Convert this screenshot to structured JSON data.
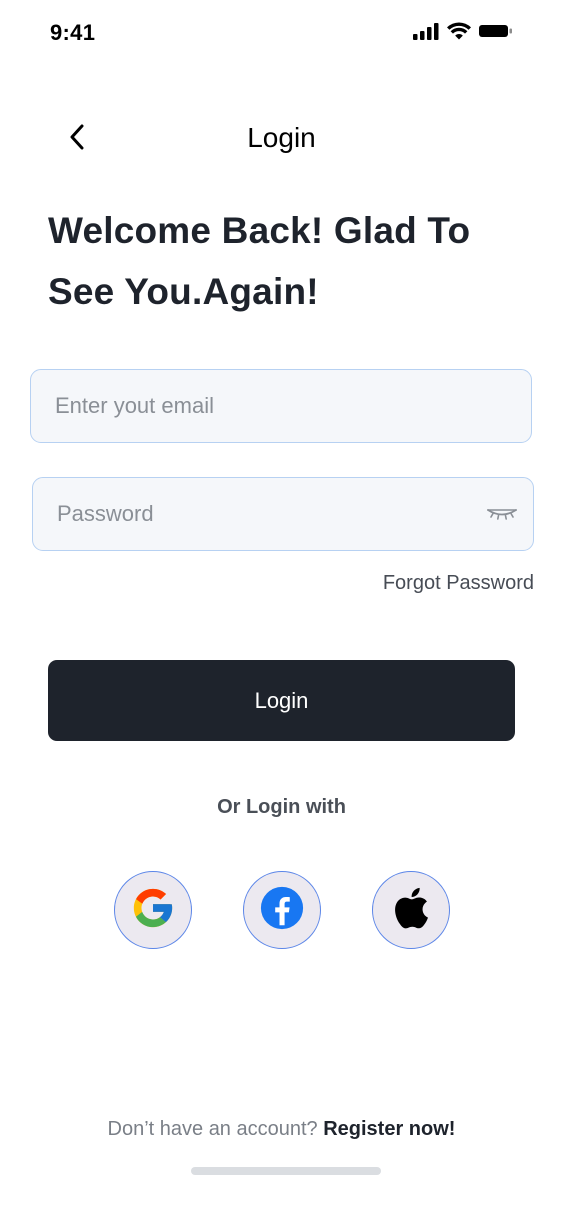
{
  "status_bar": {
    "time": "9:41"
  },
  "header": {
    "title": "Login"
  },
  "welcome": {
    "line1": "Welcome Back! Glad To",
    "line2": "See You.Again!"
  },
  "form": {
    "email": {
      "value": "",
      "placeholder": "Enter yout email"
    },
    "password": {
      "value": "",
      "placeholder": "Password"
    },
    "forgot_label": "Forgot Password",
    "login_label": "Login"
  },
  "social": {
    "divider_label": "Or Login with",
    "providers": [
      {
        "name": "google-icon"
      },
      {
        "name": "facebook-icon"
      },
      {
        "name": "apple-icon"
      }
    ]
  },
  "footer": {
    "prompt": "Don’t have an account? ",
    "register_label": "Register now!"
  },
  "colors": {
    "primary": "#1e232c",
    "input_bg": "#f5f7fa",
    "input_border": "#b7d1f2",
    "social_border": "#5c86e8",
    "facebook_blue": "#1877f2"
  }
}
